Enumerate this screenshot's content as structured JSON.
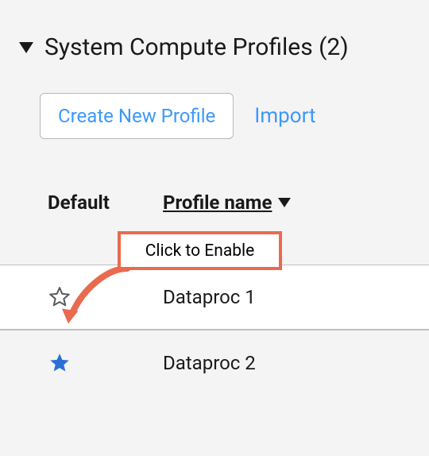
{
  "header": {
    "title": "System Compute Profiles (2)"
  },
  "actions": {
    "create_label": "Create New Profile",
    "import_label": "Import"
  },
  "columns": {
    "default_label": "Default",
    "name_label": "Profile name"
  },
  "rows": [
    {
      "name": "Dataproc 1",
      "is_default": false
    },
    {
      "name": "Dataproc 2",
      "is_default": true
    }
  ],
  "annotation": {
    "text": "Click to Enable"
  },
  "colors": {
    "link": "#3b99fc",
    "blue_star": "#2a6fd6",
    "annotation_border": "#e96a4f"
  }
}
